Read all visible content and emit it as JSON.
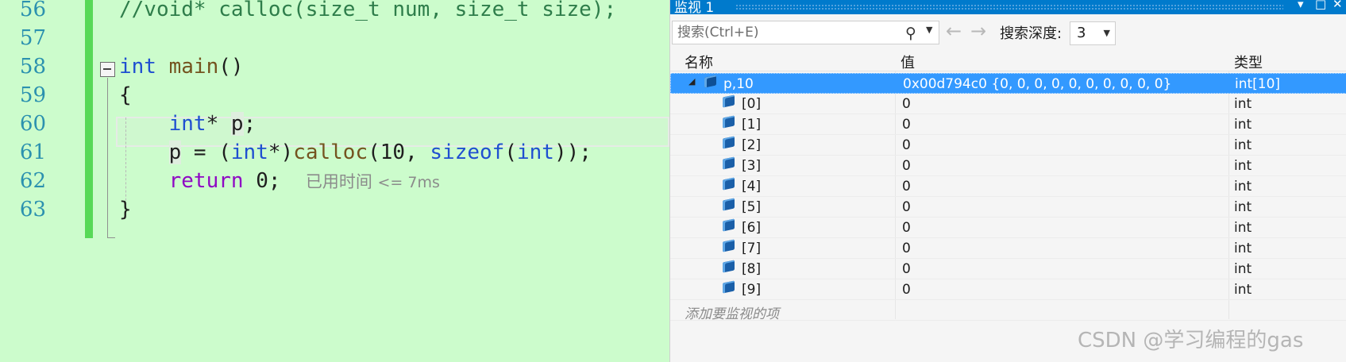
{
  "editor": {
    "lines": [
      {
        "num": "56",
        "parts": [
          [
            "cmt",
            "//void* calloc(size_t num, size_t size);"
          ]
        ]
      },
      {
        "num": "57",
        "parts": []
      },
      {
        "num": "58",
        "parts": [
          [
            "kw",
            "int"
          ],
          [
            "pl",
            " "
          ],
          [
            "fn",
            "main"
          ],
          [
            "pl",
            "()"
          ]
        ]
      },
      {
        "num": "59",
        "parts": [
          [
            "pl",
            "{"
          ]
        ]
      },
      {
        "num": "60",
        "parts": [
          [
            "pl",
            "    "
          ],
          [
            "kw",
            "int"
          ],
          [
            "pl",
            "* "
          ],
          [
            "plh",
            "p"
          ],
          [
            "pl",
            ";"
          ]
        ]
      },
      {
        "num": "61",
        "parts": [
          [
            "pl",
            "    "
          ],
          [
            "plh",
            "p"
          ],
          [
            "pl",
            " = ("
          ],
          [
            "kw",
            "int"
          ],
          [
            "pl",
            "*)"
          ],
          [
            "fn",
            "calloc"
          ],
          [
            "pl",
            "(10, "
          ],
          [
            "kw",
            "sizeof"
          ],
          [
            "pl",
            "("
          ],
          [
            "kw",
            "int"
          ],
          [
            "pl",
            "));"
          ]
        ]
      },
      {
        "num": "62",
        "parts": [
          [
            "pl",
            "    "
          ],
          [
            "rt",
            "return"
          ],
          [
            "pl",
            " 0;  "
          ]
        ]
      },
      {
        "num": "63",
        "parts": [
          [
            "pl",
            "}"
          ]
        ]
      }
    ],
    "elapsed_label": "已用时间",
    "elapsed_value": "<= 7ms"
  },
  "watch": {
    "title": "监视 1",
    "search_placeholder": "搜索(Ctrl+E)",
    "depth_label": "搜索深度:",
    "depth_value": "3",
    "columns": {
      "name": "名称",
      "value": "值",
      "type": "类型"
    },
    "root": {
      "name": "p,10",
      "value": "0x00d794c0 {0, 0, 0, 0, 0, 0, 0, 0, 0, 0}",
      "type": "int[10]"
    },
    "children": [
      {
        "name": "[0]",
        "value": "0",
        "type": "int"
      },
      {
        "name": "[1]",
        "value": "0",
        "type": "int"
      },
      {
        "name": "[2]",
        "value": "0",
        "type": "int"
      },
      {
        "name": "[3]",
        "value": "0",
        "type": "int"
      },
      {
        "name": "[4]",
        "value": "0",
        "type": "int"
      },
      {
        "name": "[5]",
        "value": "0",
        "type": "int"
      },
      {
        "name": "[6]",
        "value": "0",
        "type": "int"
      },
      {
        "name": "[7]",
        "value": "0",
        "type": "int"
      },
      {
        "name": "[8]",
        "value": "0",
        "type": "int"
      },
      {
        "name": "[9]",
        "value": "0",
        "type": "int"
      }
    ],
    "add_item": "添加要监视的项",
    "watermark": "CSDN @学习编程的gas"
  },
  "colors": {
    "selection": "#3399ff",
    "titlebar": "#007acc",
    "editor_bg": "#ccfccc"
  }
}
